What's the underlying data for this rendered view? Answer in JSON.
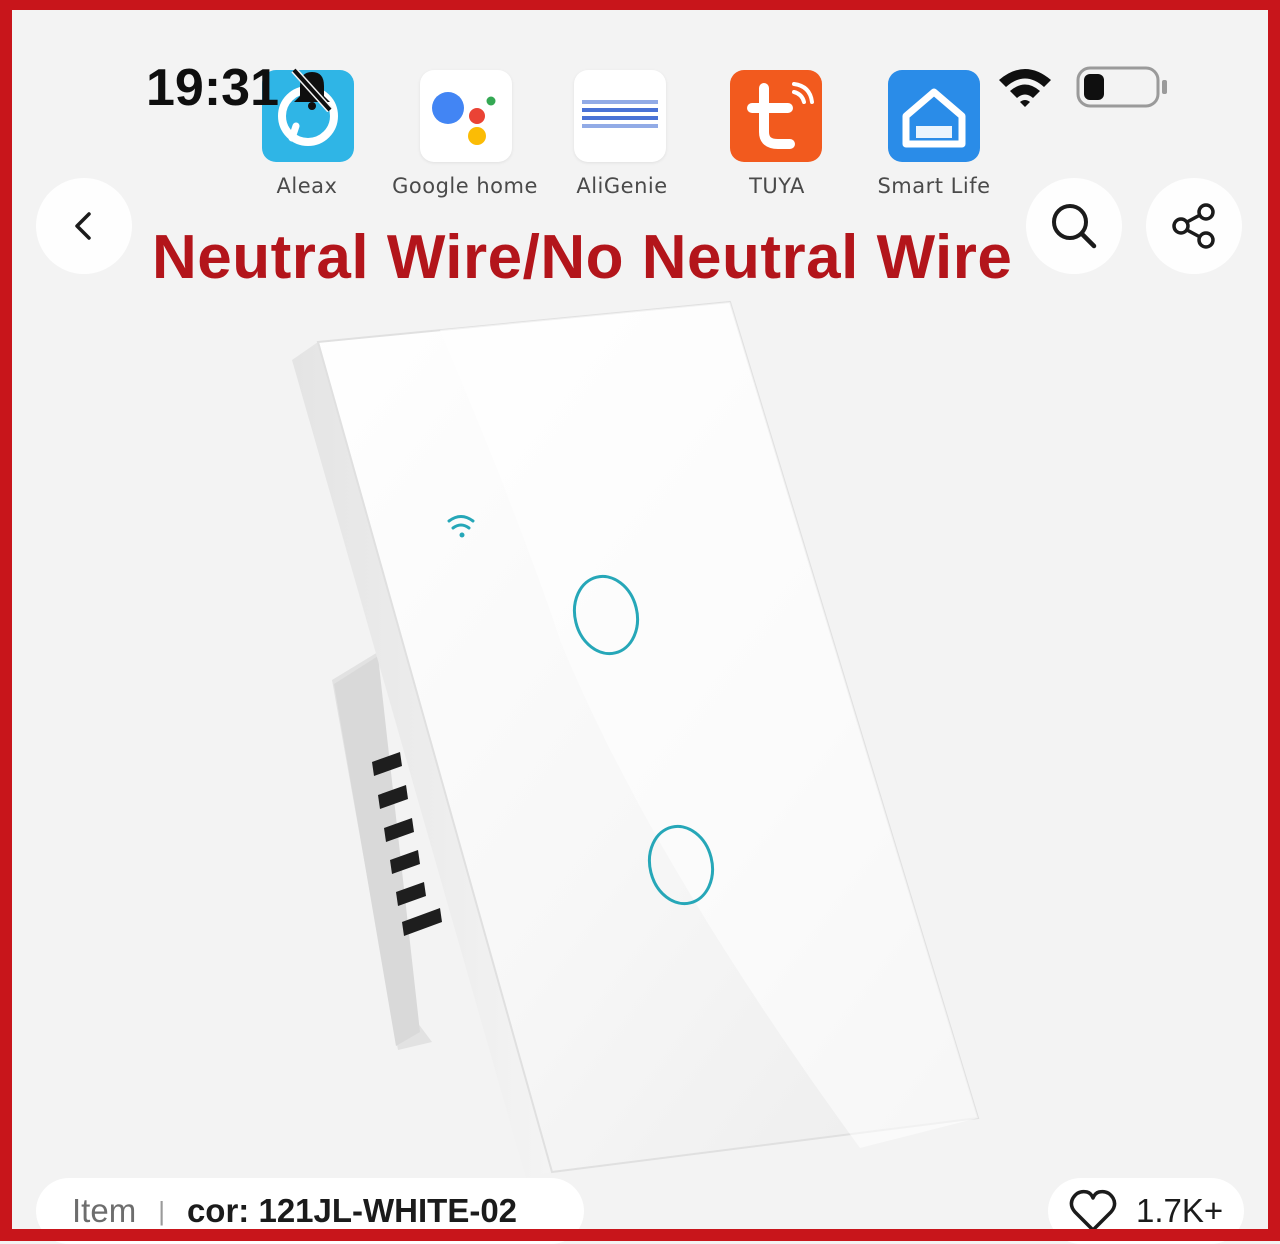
{
  "status_bar": {
    "time": "19:31",
    "icons": [
      "bell-muted-icon",
      "wifi-icon",
      "battery-icon"
    ]
  },
  "banner": {
    "apps": [
      {
        "label": "Aleax",
        "icon": "alexa-logo-icon",
        "color": "#2fb5e6"
      },
      {
        "label": "Google home",
        "icon": "google-assistant-logo-icon",
        "color": "#ffffff"
      },
      {
        "label": "AliGenie",
        "icon": "aligenie-logo-icon",
        "color": "#ffffff"
      },
      {
        "label": "TUYA",
        "icon": "tuya-logo-icon",
        "color": "#f25a1e"
      },
      {
        "label": "Smart Life",
        "icon": "smart-life-logo-icon",
        "color": "#2a8ce8"
      }
    ],
    "headline": "Neutral Wire/No Neutral Wire",
    "headline_color": "#b3151b"
  },
  "nav": {
    "back_icon": "chevron-left-icon",
    "search_icon": "search-icon",
    "share_icon": "share-icon"
  },
  "product": {
    "item_label": "Item",
    "separator": "|",
    "variant": "cor: 121JL-WHITE-02",
    "likes": "1.7K+",
    "like_icon": "heart-outline-icon"
  },
  "colors": {
    "frame": "#c8151b",
    "touch_ring": "#26a7b8",
    "background": "#f3f3f3"
  }
}
